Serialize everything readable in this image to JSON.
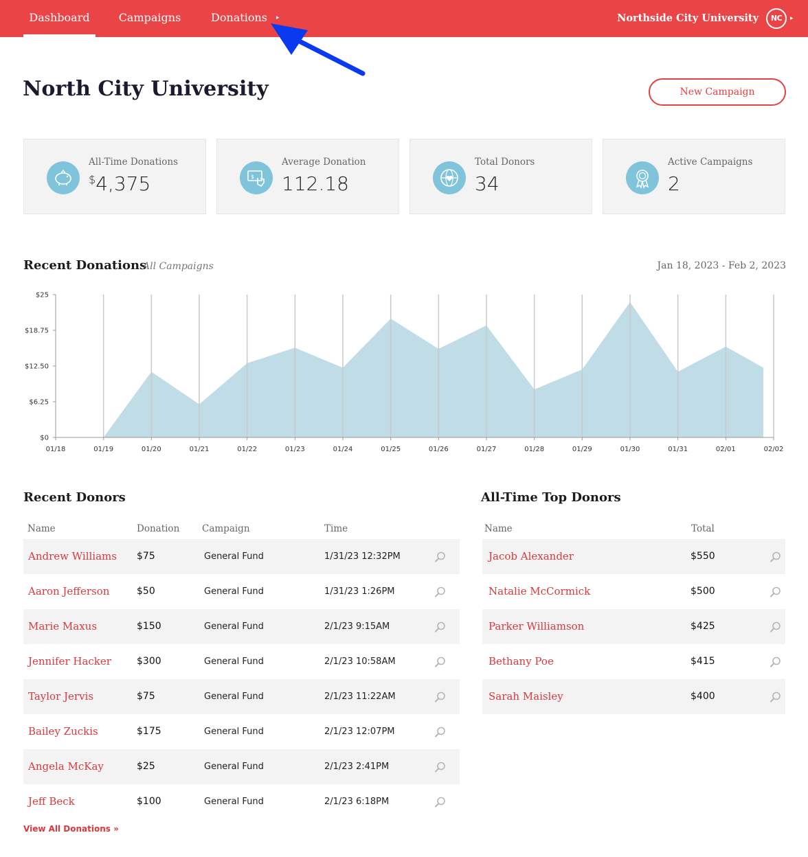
{
  "nav": {
    "items": [
      {
        "label": "Dashboard"
      },
      {
        "label": "Campaigns"
      },
      {
        "label": "Donations"
      }
    ],
    "caret": "▸",
    "org_name": "Northside City University",
    "org_badge": "NC"
  },
  "header": {
    "title": "North City University",
    "new_campaign_label": "New Campaign"
  },
  "stats": [
    {
      "label": "All-Time Donations",
      "prefix": "$",
      "value": "4,375",
      "icon": "piggy-bank-icon"
    },
    {
      "label": "Average Donation",
      "prefix": "",
      "value": "112.18",
      "icon": "cheque-hand-icon"
    },
    {
      "label": "Total Donors",
      "prefix": "",
      "value": "34",
      "icon": "globe-heart-icon"
    },
    {
      "label": "Active Campaigns",
      "prefix": "",
      "value": "2",
      "icon": "ribbon-award-icon"
    }
  ],
  "chart_section": {
    "title": "Recent Donations",
    "subtitle": "All Campaigns",
    "date_range": "Jan 18, 2023 - Feb 2, 2023"
  },
  "chart_data": {
    "type": "area",
    "x": [
      "01/18",
      "01/19",
      "01/20",
      "01/21",
      "01/22",
      "01/23",
      "01/24",
      "01/25",
      "01/26",
      "01/27",
      "01/28",
      "01/29",
      "01/30",
      "01/31",
      "02/01",
      "02/02"
    ],
    "y_tick_labels": [
      "$0",
      "$6.25",
      "$12.50",
      "$18.75",
      "$25"
    ],
    "ylim": [
      0,
      25
    ],
    "series": [
      {
        "values": [
          null,
          0,
          11.5,
          5.8,
          13,
          15.7,
          12.2,
          20.8,
          15.5,
          19.6,
          8.4,
          11.9,
          23.7,
          11.5,
          15.9,
          12.2
        ]
      }
    ],
    "grid": "vertical",
    "fill_color": "#bfdce7",
    "grid_color": "#c9c9c9"
  },
  "recent_donors": {
    "title": "Recent Donors",
    "columns": [
      "Name",
      "Donation",
      "Campaign",
      "Time"
    ],
    "rows": [
      {
        "name": "Andrew Williams",
        "donation": "$75",
        "campaign": "General Fund",
        "time": "1/31/23 12:32PM"
      },
      {
        "name": "Aaron Jefferson",
        "donation": "$50",
        "campaign": "General Fund",
        "time": "1/31/23 1:26PM"
      },
      {
        "name": "Marie Maxus",
        "donation": "$150",
        "campaign": "General Fund",
        "time": "2/1/23 9:15AM"
      },
      {
        "name": "Jennifer Hacker",
        "donation": "$300",
        "campaign": "General Fund",
        "time": "2/1/23 10:58AM"
      },
      {
        "name": "Taylor Jervis",
        "donation": "$75",
        "campaign": "General Fund",
        "time": "2/1/23 11:22AM"
      },
      {
        "name": "Bailey Zuckis",
        "donation": "$175",
        "campaign": "General Fund",
        "time": "2/1/23 12:07PM"
      },
      {
        "name": "Angela McKay",
        "donation": "$25",
        "campaign": "General Fund",
        "time": "2/1/23 2:41PM"
      },
      {
        "name": "Jeff Beck",
        "donation": "$100",
        "campaign": "General Fund",
        "time": "2/1/23 6:18PM"
      }
    ],
    "view_all": "View All Donations »"
  },
  "top_donors": {
    "title": "All-Time Top Donors",
    "columns": [
      "Name",
      "Total"
    ],
    "rows": [
      {
        "name": "Jacob Alexander",
        "total": "$550"
      },
      {
        "name": "Natalie McCormick",
        "total": "$500"
      },
      {
        "name": "Parker Williamson",
        "total": "$425"
      },
      {
        "name": "Bethany Poe",
        "total": "$415"
      },
      {
        "name": "Sarah Maisley",
        "total": "$400"
      }
    ]
  },
  "colors": {
    "brand_red": "#ea4446",
    "link_red": "#d9393c",
    "icon_blue": "#7fc4da",
    "annotation_arrow": "#0a3af0"
  }
}
